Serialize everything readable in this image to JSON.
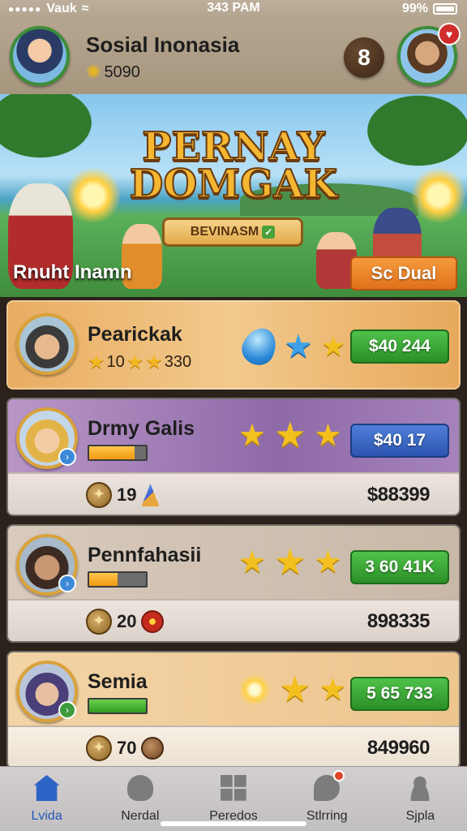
{
  "status_bar": {
    "carrier": "Vauk",
    "time": "343 PAM",
    "battery": "99%"
  },
  "profile": {
    "name": "Sosial Inonasia",
    "coins": "5090",
    "settings_glyph": "8"
  },
  "banner": {
    "title_line1": "PERNAY",
    "title_line2": "DOMGAK",
    "subtitle": "BEVINASM",
    "caption": "Rnuht Inamn",
    "action_label": "Sc Dual"
  },
  "players": [
    {
      "name": "Pearickak",
      "stat_a": "10",
      "stat_b": "330",
      "price": "$40 244",
      "price_color": "green"
    },
    {
      "name": "Drmy Galis",
      "progress": 0.8,
      "price": "$40 17",
      "price_color": "blue",
      "resource": "19",
      "score": "$88399"
    },
    {
      "name": "Pennfahasii",
      "progress": 0.5,
      "price": "3 60 41K",
      "price_color": "green",
      "resource": "20",
      "score": "898335"
    },
    {
      "name": "Semia",
      "progress": 1.0,
      "price": "5 65 733",
      "price_color": "green",
      "resource": "70",
      "score": "849960"
    }
  ],
  "tabs": [
    {
      "label": "Lvida",
      "icon": "home-icon",
      "active": true
    },
    {
      "label": "Nerdal",
      "icon": "cloud-icon",
      "active": false
    },
    {
      "label": "Peredos",
      "icon": "grid-icon",
      "active": false
    },
    {
      "label": "Stlrring",
      "icon": "chat-icon",
      "active": false
    },
    {
      "label": "Sjpla",
      "icon": "person-icon",
      "active": false
    }
  ],
  "colors": {
    "accent_blue": "#2d63c4",
    "price_green": "#3aa833",
    "price_blue": "#3a66c4",
    "action_orange": "#ea8126"
  }
}
